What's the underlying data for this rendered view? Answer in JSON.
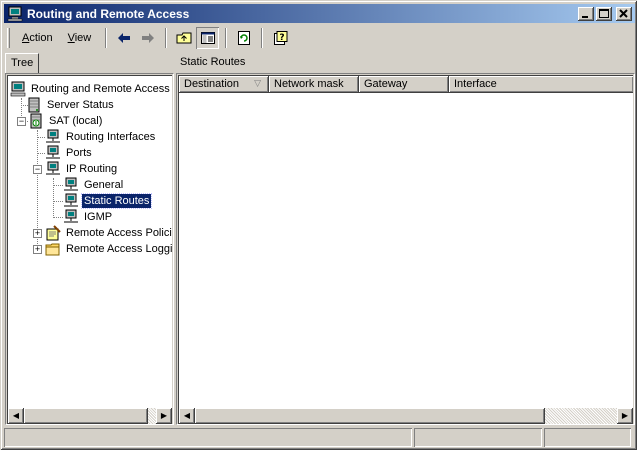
{
  "window": {
    "title": "Routing and Remote Access",
    "controls": {
      "minimize": "_",
      "maximize": "□",
      "close": "✕"
    }
  },
  "menu": {
    "action": "Action",
    "action_mnemonic": "A",
    "action_rest": "ction",
    "view": "View",
    "view_mnemonic": "V",
    "view_rest": "iew"
  },
  "tree": {
    "tab_label": "Tree",
    "root": "Routing and Remote Access",
    "server_status": "Server Status",
    "server": "SAT (local)",
    "routing_interfaces": "Routing Interfaces",
    "ports": "Ports",
    "ip_routing": "IP Routing",
    "general": "General",
    "static_routes": "Static Routes",
    "igmp": "IGMP",
    "remote_access_policies": "Remote Access Policie",
    "remote_access_logging": "Remote Access Loggin"
  },
  "details": {
    "title": "Static Routes",
    "columns": [
      "Destination",
      "Network mask",
      "Gateway",
      "Interface"
    ],
    "rows": []
  },
  "colors": {
    "title_start": "#0a246a",
    "title_end": "#a6caf0",
    "selection": "#0a246a",
    "face": "#d4d0c8"
  }
}
